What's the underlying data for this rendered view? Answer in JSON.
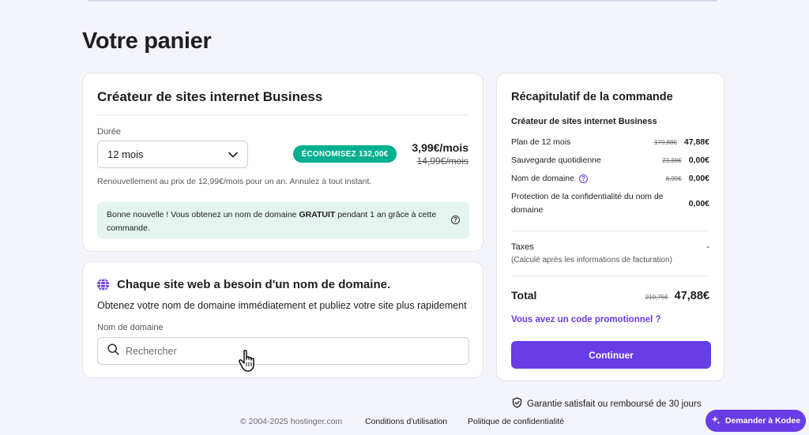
{
  "page_title": "Votre panier",
  "product": {
    "title": "Créateur de sites internet Business",
    "duration_label": "Durée",
    "duration_value": "12 mois",
    "savings_badge": "ÉCONOMISEZ 132,00€",
    "price": "3,99€/mois",
    "old_price": "14,99€/mois",
    "renewal_note": "Renouvellement au prix de 12,99€/mois pour un an. Annulez à tout instant.",
    "info_prefix": "Bonne nouvelle ! Vous obtenez un nom de domaine ",
    "info_bold": "GRATUIT",
    "info_suffix": " pendant 1 an grâce à cette commande."
  },
  "domain": {
    "heading": "Chaque site web a besoin d'un nom de domaine.",
    "subtitle": "Obtenez votre nom de domaine immédiatement et publiez votre site plus rapidement",
    "field_label": "Nom de domaine",
    "search_placeholder": "Rechercher"
  },
  "summary": {
    "title": "Récapitulatif de la commande",
    "product": "Créateur de sites internet Business",
    "rows": [
      {
        "label": "Plan de 12 mois",
        "old": "179,88€",
        "value": "47,88€"
      },
      {
        "label": "Sauvegarde quotidienne",
        "old": "23,88€",
        "value": "0,00€"
      },
      {
        "label": "Nom de domaine",
        "old": "6,99€",
        "value": "0,00€"
      },
      {
        "label": "Protection de la confidentialité du nom de domaine",
        "old": "",
        "value": "0,00€"
      }
    ],
    "taxes_label": "Taxes",
    "taxes_value": "-",
    "taxes_note": "(Calculé après les informations de facturation)",
    "total_label": "Total",
    "total_old": "210,75€",
    "total_value": "47,88€",
    "promo_link": "Vous avez un code promotionnel ?",
    "continue_label": "Continuer"
  },
  "guarantee": "Garantie satisfait ou remboursé de 30 jours",
  "footer": {
    "copyright": "© 2004-2025 hostinger.com",
    "terms": "Conditions d'utilisation",
    "privacy": "Politique de confidentialité"
  },
  "kodee_button": "Demander à Kodee",
  "colors": {
    "accent": "#673de6",
    "success": "#00b090",
    "info_bg": "#e4f4ee"
  }
}
